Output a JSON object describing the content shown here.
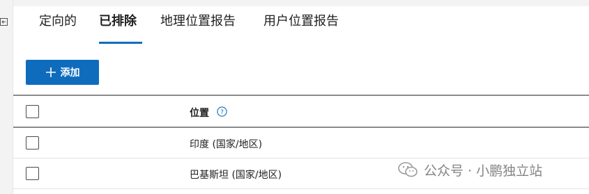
{
  "tabs": [
    {
      "label": "定向的",
      "active": false
    },
    {
      "label": "已排除",
      "active": true
    },
    {
      "label": "地理位置报告",
      "active": false
    },
    {
      "label": "用户位置报告",
      "active": false
    }
  ],
  "toolbar": {
    "add_label": "添加",
    "add_icon": "plus-icon"
  },
  "table": {
    "column_header": "位置",
    "help_icon": "help-icon",
    "rows": [
      {
        "location": "印度 (国家/地区)",
        "selected": false
      },
      {
        "location": "巴基斯坦 (国家/地区)",
        "selected": false
      }
    ]
  },
  "watermark": {
    "text": "公众号 · 小鹏独立站"
  },
  "colors": {
    "accent": "#0f6cbd",
    "background": "#f3f3f3",
    "panel": "#ffffff"
  }
}
